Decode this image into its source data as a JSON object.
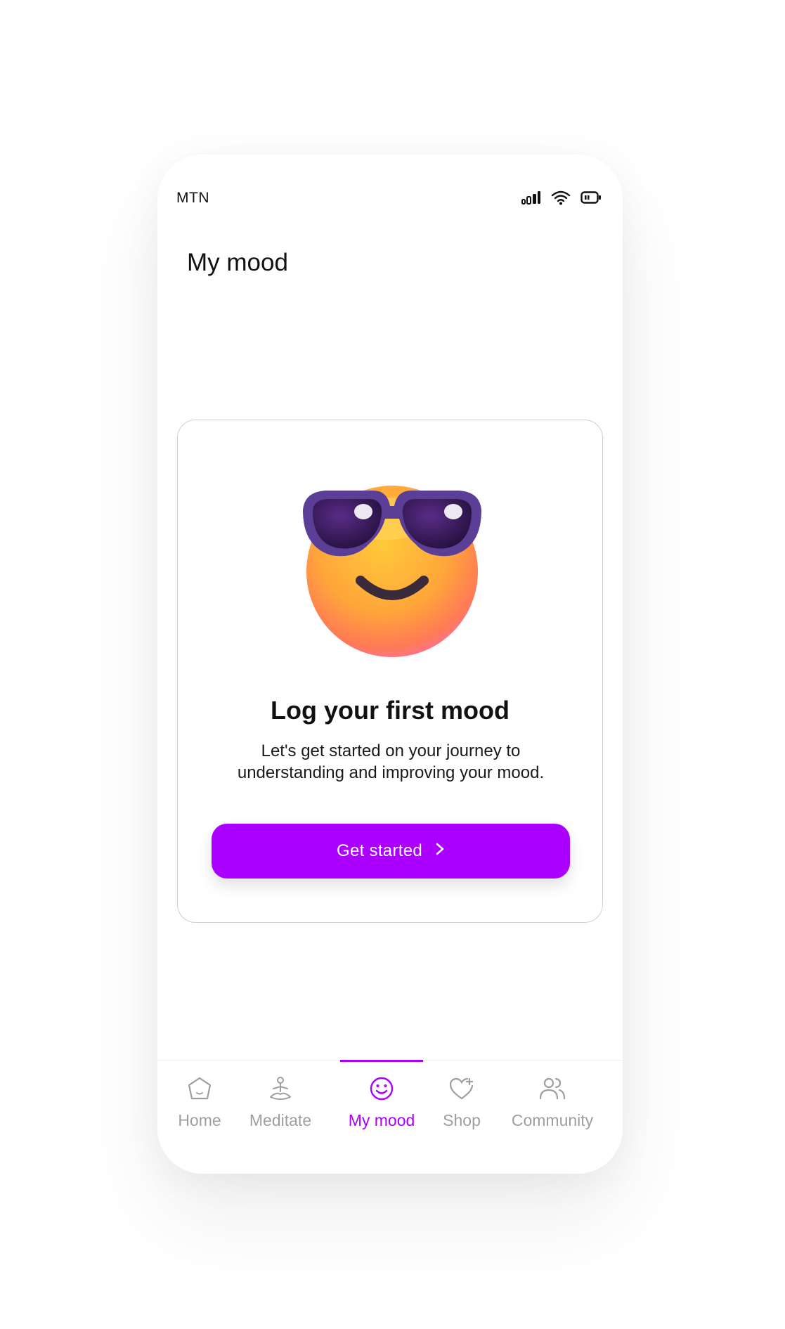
{
  "status_bar": {
    "carrier": "MTN",
    "icons": [
      "signal-icon",
      "wifi-icon",
      "battery-icon"
    ]
  },
  "header": {
    "title": "My mood"
  },
  "empty_state": {
    "illustration": "sunglasses-smiley-emoji",
    "title": "Log your first mood",
    "subtitle": "Let's get started on your journey to understanding and improving your mood.",
    "cta_label": "Get started",
    "cta_icon": "chevron-right-icon"
  },
  "tabs": [
    {
      "label": "Home",
      "icon": "home-icon",
      "active": false
    },
    {
      "label": "Meditate",
      "icon": "meditate-icon",
      "active": false
    },
    {
      "label": "My mood",
      "icon": "smiley-icon",
      "active": true
    },
    {
      "label": "Shop",
      "icon": "heart-plus-icon",
      "active": false
    },
    {
      "label": "Community",
      "icon": "people-icon",
      "active": false
    }
  ],
  "colors": {
    "accent": "#AB00FF",
    "inactive_tab": "#9E9E9E",
    "text": "#111111",
    "card_border": "#CFCFCF"
  }
}
